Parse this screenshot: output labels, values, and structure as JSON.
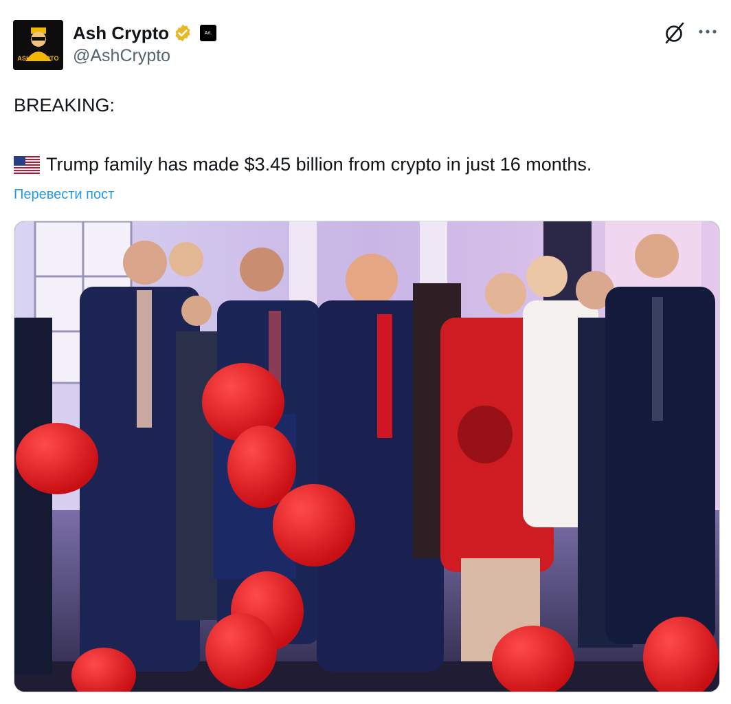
{
  "author": {
    "display_name": "Ash Crypto",
    "handle": "@AshCrypto",
    "avatar_label": "ASH CRYPTO",
    "affiliate_badge": "Art.",
    "verified": true,
    "verified_color": "#e8b829"
  },
  "post": {
    "line1": "BREAKING:",
    "line2": "Trump family has made $3.45 billion from crypto in just 16 months.",
    "flag_icon": "us-flag-icon"
  },
  "translate_label": "Перевести пост",
  "icons": {
    "grok": "grok-icon",
    "more": "more-icon"
  },
  "colors": {
    "link": "#1d9bf0",
    "text": "#0f1419",
    "secondary": "#536471",
    "balloon": "#e11d24"
  }
}
